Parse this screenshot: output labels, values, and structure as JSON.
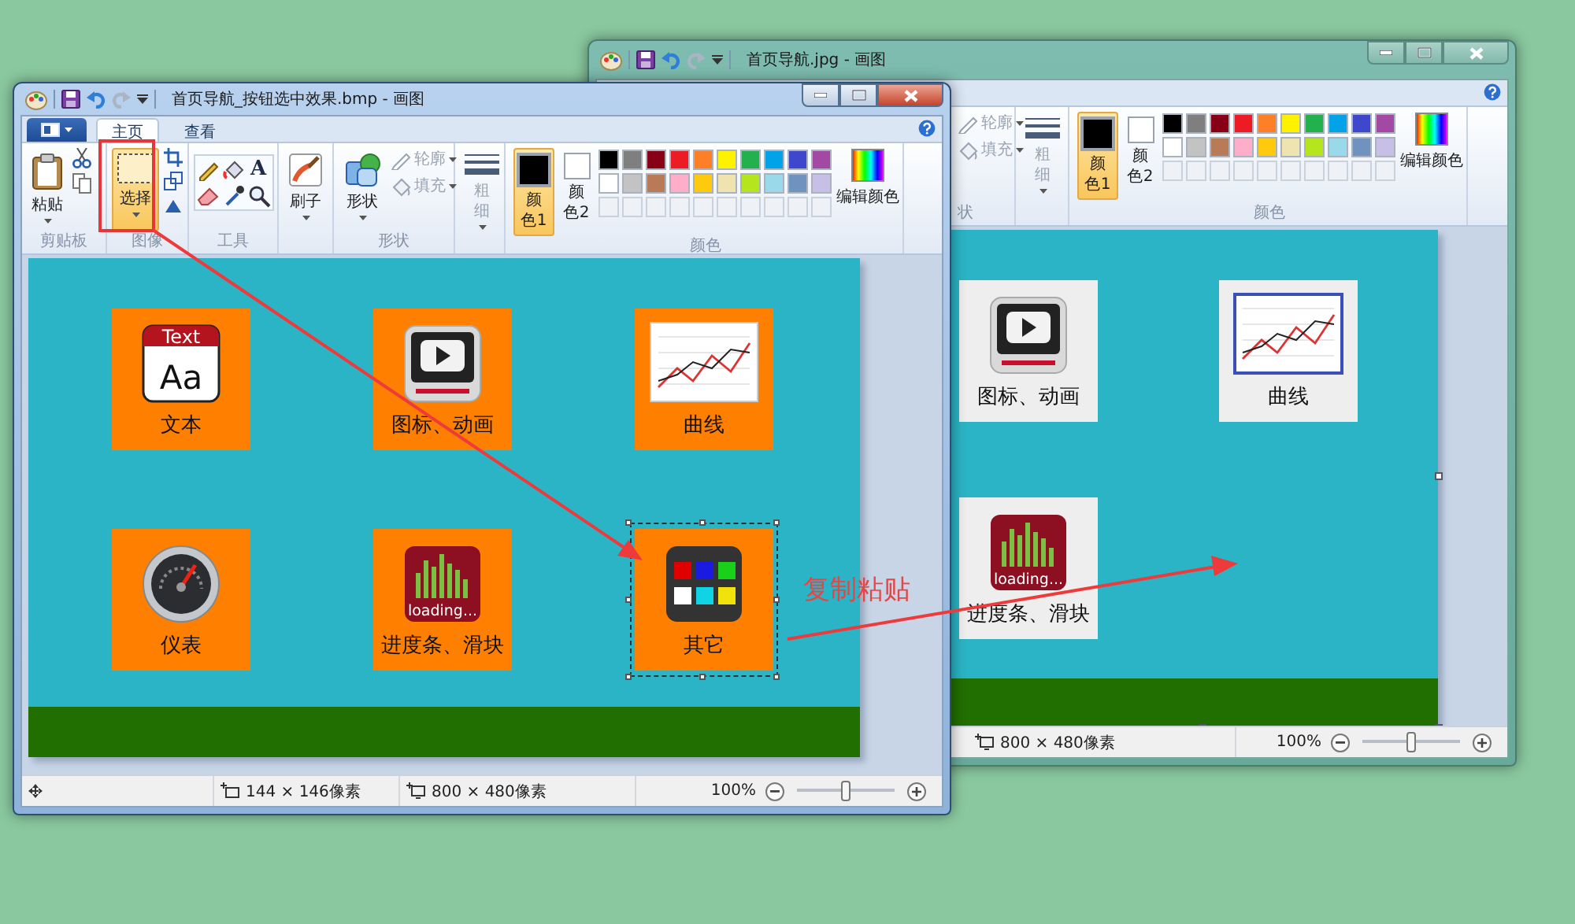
{
  "back_window": {
    "active": false,
    "title": "首页导航.jpg - 画图",
    "ribbon": {
      "shapes_group": {
        "label": "状",
        "outline": {
          "label": "轮廓",
          "disabled": true
        },
        "fill": {
          "label": "填充",
          "disabled": true
        }
      },
      "size": {
        "label": "粗细",
        "disabled": true
      },
      "colors_group": {
        "label": "颜色",
        "color1": {
          "label": "颜色 1",
          "color": "#000000",
          "selected": true
        },
        "color2": {
          "label": "颜色 2",
          "color": "#ffffff",
          "selected": false
        },
        "palette": [
          {
            "color": "#000000"
          },
          {
            "color": "#7f7f7f"
          },
          {
            "color": "#880015"
          },
          {
            "color": "#ed1c24"
          },
          {
            "color": "#ff7f27"
          },
          {
            "color": "#fff200"
          },
          {
            "color": "#22b14c"
          },
          {
            "color": "#00a2e8"
          },
          {
            "color": "#3f48cc"
          },
          {
            "color": "#a349a4"
          },
          {
            "color": "#ffffff"
          },
          {
            "color": "#c3c3c3"
          },
          {
            "color": "#b97a57"
          },
          {
            "color": "#ffaec9"
          },
          {
            "color": "#ffc90e"
          },
          {
            "color": "#efe4b0"
          },
          {
            "color": "#b5e61d"
          },
          {
            "color": "#99d9ea"
          },
          {
            "color": "#7092be"
          },
          {
            "color": "#c8bfe7"
          }
        ],
        "edit": "编辑颜色"
      }
    },
    "canvas": {
      "kind": "gray",
      "tiles": [
        {
          "label": "图标、动画",
          "kind": "video",
          "selected": false
        },
        {
          "label": "曲线",
          "kind": "chart",
          "selected": false
        },
        {
          "label": "进度条、滑块",
          "kind": "progress",
          "icon_texts": [
            "loading..."
          ],
          "selected": false
        }
      ]
    },
    "status_bar": {
      "image_size": "800 × 480像素",
      "zoom": "100%",
      "zoom_slider": {
        "level": 0.5
      }
    }
  },
  "front_window": {
    "active": true,
    "title": "首页导航_按钮选中效果.bmp - 画图",
    "tabs": [
      {
        "label": "主页",
        "selected": true
      },
      {
        "label": "查看",
        "selected": false
      }
    ],
    "ribbon": {
      "clipboard_group": {
        "label": "剪贴板",
        "paste": "粘贴"
      },
      "image_group": {
        "label": "图像",
        "select": {
          "label": "选择",
          "selected": true
        }
      },
      "tools_group": {
        "label": "工具",
        "text_tool": "A"
      },
      "brushes": "刷子",
      "shapes_group": {
        "label": "形状",
        "shapes": "形状",
        "outline": {
          "label": "轮廓",
          "disabled": true
        },
        "fill": {
          "label": "填充",
          "disabled": true
        }
      },
      "size": {
        "label": "粗细",
        "disabled": true
      },
      "colors_group": {
        "label": "颜色",
        "color1": {
          "label": "颜色 1",
          "color": "#000000",
          "selected": true
        },
        "color2": {
          "label": "颜色 2",
          "color": "#ffffff",
          "selected": false
        },
        "palette": [
          {
            "color": "#000000"
          },
          {
            "color": "#7f7f7f"
          },
          {
            "color": "#880015"
          },
          {
            "color": "#ed1c24"
          },
          {
            "color": "#ff7f27"
          },
          {
            "color": "#fff200"
          },
          {
            "color": "#22b14c"
          },
          {
            "color": "#00a2e8"
          },
          {
            "color": "#3f48cc"
          },
          {
            "color": "#a349a4"
          },
          {
            "color": "#ffffff"
          },
          {
            "color": "#c3c3c3"
          },
          {
            "color": "#b97a57"
          },
          {
            "color": "#ffaec9"
          },
          {
            "color": "#ffc90e"
          },
          {
            "color": "#efe4b0"
          },
          {
            "color": "#b5e61d"
          },
          {
            "color": "#99d9ea"
          },
          {
            "color": "#7092be"
          },
          {
            "color": "#c8bfe7"
          }
        ],
        "edit": "编辑颜色"
      }
    },
    "canvas": {
      "kind": "orange",
      "tiles": [
        {
          "label": "文本",
          "kind": "text",
          "icon_texts": [
            "Text",
            "Aa"
          ],
          "selected": false
        },
        {
          "label": "图标、动画",
          "kind": "video",
          "selected": false
        },
        {
          "label": "曲线",
          "kind": "chart",
          "selected": false
        },
        {
          "label": "仪表",
          "kind": "gauge",
          "selected": false
        },
        {
          "label": "进度条、滑块",
          "kind": "progress",
          "icon_texts": [
            "loading..."
          ],
          "selected": false
        },
        {
          "label": "其它",
          "kind": "grid",
          "selected": true
        }
      ]
    },
    "status_bar": {
      "selection_size": "144 × 146像素",
      "image_size": "800 × 480像素",
      "zoom": "100%",
      "zoom_slider": {
        "level": 0.5
      }
    }
  },
  "annotation": "复制粘贴"
}
